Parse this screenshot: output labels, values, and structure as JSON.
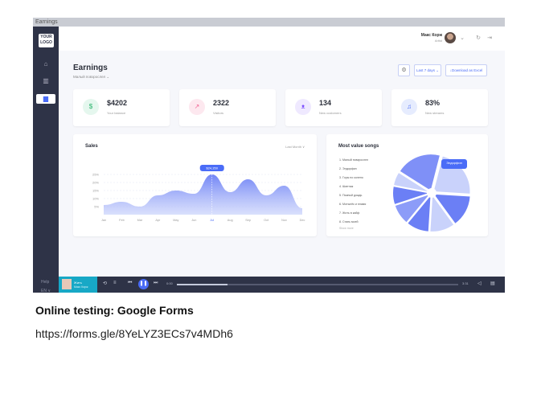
{
  "window": {
    "title": "Earnings"
  },
  "sidebar": {
    "logo": "YOUR LOGO",
    "items": [
      {
        "icon": "home-icon",
        "glyph": "⌂"
      },
      {
        "icon": "bar-chart-icon",
        "glyph": "▥"
      },
      {
        "icon": "document-icon",
        "glyph": "▆"
      }
    ],
    "help": "Help",
    "lang": "EN ∨"
  },
  "header": {
    "user_name": "Макс Корж",
    "user_role": "Artist",
    "chevron": "⌄",
    "refresh_glyph": "↻",
    "logout_glyph": "⇥"
  },
  "page": {
    "title": "Earnings",
    "subtitle": "Малый повзрослел ⌄",
    "settings_glyph": "⚙",
    "period_label": "Last 7 days ⌄",
    "download_label": "↓Download as Excel"
  },
  "stats": [
    {
      "value": "$4202",
      "label": "Your balance",
      "icon": "dollar-icon",
      "glyph": "$",
      "color": "#27b36a",
      "bg": "#e5f7ee"
    },
    {
      "value": "2322",
      "label": "Visitors",
      "icon": "trend-icon",
      "glyph": "↗",
      "color": "#f06292",
      "bg": "#fde8ef"
    },
    {
      "value": "134",
      "label": "New customers",
      "icon": "user-icon",
      "glyph": "ᴥ",
      "color": "#7c4dff",
      "bg": "#efe9ff"
    },
    {
      "value": "83%",
      "label": "New streams",
      "icon": "music-icon",
      "glyph": "♫",
      "color": "#4a6cf7",
      "bg": "#e6ecfe"
    }
  ],
  "sales": {
    "title": "Sales",
    "period": "Last Month ∨",
    "tooltip": "$24,350"
  },
  "songs": {
    "title": "Most value songs",
    "items": [
      "1. Малый повзрослел",
      "2. Эндорфин",
      "3. Горы по колено",
      "4. Шантаж",
      "5. Пьяный дождь",
      "6. Мотылёк и пламя",
      "7. Жить в кайф",
      "8. Стань моей"
    ],
    "show_more": "Show more",
    "badge": "Эндорфин"
  },
  "chart_data": [
    {
      "type": "area",
      "title": "Sales",
      "categories": [
        "Jan",
        "Feb",
        "Mar",
        "Apr",
        "May",
        "Jun",
        "Jul",
        "Aug",
        "Sep",
        "Oct",
        "Nov",
        "Dec"
      ],
      "values": [
        6,
        8,
        5,
        12,
        15,
        13,
        25,
        14,
        22,
        12,
        18,
        4
      ],
      "yticks": [
        "5%",
        "10%",
        "15%",
        "20%",
        "25%"
      ],
      "ylim": [
        0,
        30
      ],
      "color": "#6b7ff5"
    },
    {
      "type": "pie",
      "title": "Most value songs",
      "values": [
        22,
        14,
        11,
        10,
        9,
        8,
        6,
        20
      ],
      "colors": [
        "#c9d2fb",
        "#6b7ff5",
        "#c9d2fb",
        "#6b7ff5",
        "#8c9cf8",
        "#6b7ff5",
        "#c9d2fb",
        "#7f90f7"
      ]
    }
  ],
  "player": {
    "title": "Жить",
    "artist": "Макс Корж",
    "time_elapsed": "0:00",
    "time_total": "3:31",
    "progress": 0.18
  },
  "caption": "Online testing: Google Forms",
  "link": "https://forms.gle/8YeLYZ3ECs7v4MDh6"
}
